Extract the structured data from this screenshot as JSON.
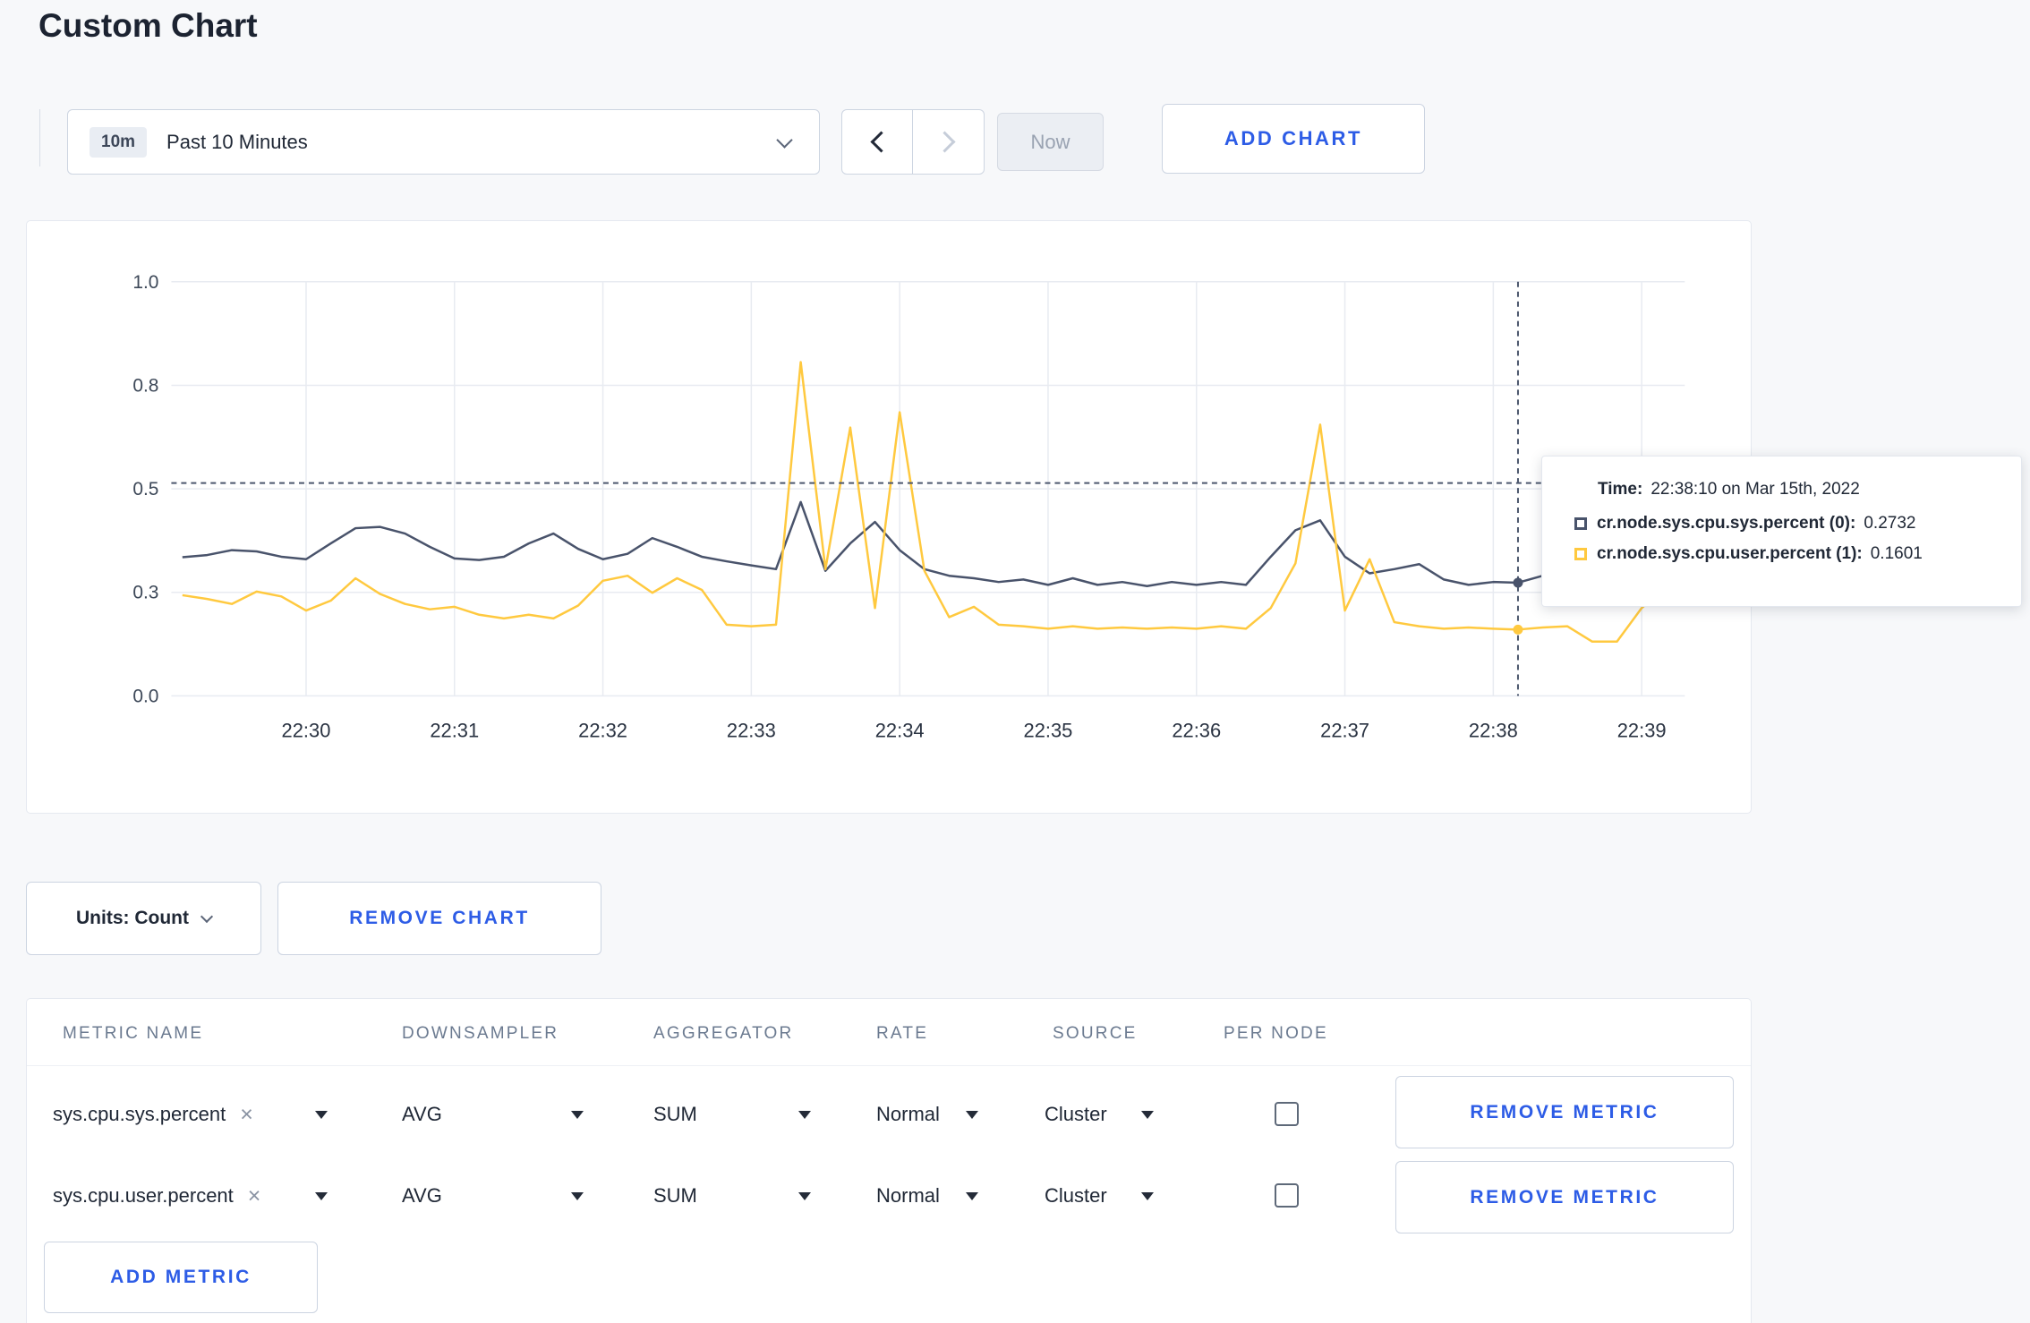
{
  "page": {
    "title": "Custom Chart"
  },
  "controls": {
    "timeframe_badge": "10m",
    "timeframe_label": "Past 10 Minutes",
    "now_label": "Now",
    "add_chart_label": "ADD CHART",
    "units_label": "Units: Count",
    "remove_chart_label": "REMOVE CHART"
  },
  "icons": {
    "clear": "×"
  },
  "tooltip": {
    "time_label": "Time:",
    "time_value": "22:38:10 on Mar 15th, 2022",
    "rows": [
      {
        "label": "cr.node.sys.cpu.sys.percent (0):",
        "value": "0.2732",
        "color": "#49536b"
      },
      {
        "label": "cr.node.sys.cpu.user.percent (1):",
        "value": "0.1601",
        "color": "#ffc93f"
      }
    ]
  },
  "chart_data": {
    "type": "line",
    "title": "",
    "xlabel": "",
    "ylabel": "",
    "ylim": [
      0,
      1
    ],
    "grid": true,
    "legend_position": "tooltip",
    "x_window": {
      "start": "22:29:00",
      "end": "22:39:00",
      "seconds": 600
    },
    "y_ticks": [
      {
        "pos": 0.0,
        "label": "0.0"
      },
      {
        "pos": 0.25,
        "label": "0.3"
      },
      {
        "pos": 0.5,
        "label": "0.5"
      },
      {
        "pos": 0.75,
        "label": "0.8"
      },
      {
        "pos": 1.0,
        "label": "1.0"
      }
    ],
    "x_ticks": [
      {
        "t": 60,
        "label": "22:30"
      },
      {
        "t": 120,
        "label": "22:31"
      },
      {
        "t": 180,
        "label": "22:32"
      },
      {
        "t": 240,
        "label": "22:33"
      },
      {
        "t": 300,
        "label": "22:34"
      },
      {
        "t": 360,
        "label": "22:35"
      },
      {
        "t": 420,
        "label": "22:36"
      },
      {
        "t": 480,
        "label": "22:37"
      },
      {
        "t": 540,
        "label": "22:38"
      },
      {
        "t": 600,
        "label": "22:39"
      }
    ],
    "crosshair": {
      "t": 550,
      "time": "22:38:10",
      "y_value": 0.514
    },
    "series": [
      {
        "name": "cr.node.sys.cpu.sys.percent",
        "color": "#49536b",
        "points": [
          [
            10,
            0.335
          ],
          [
            20,
            0.34
          ],
          [
            30,
            0.352
          ],
          [
            40,
            0.349
          ],
          [
            50,
            0.336
          ],
          [
            60,
            0.33
          ],
          [
            70,
            0.368
          ],
          [
            80,
            0.405
          ],
          [
            90,
            0.408
          ],
          [
            100,
            0.392
          ],
          [
            110,
            0.36
          ],
          [
            120,
            0.332
          ],
          [
            130,
            0.328
          ],
          [
            140,
            0.336
          ],
          [
            150,
            0.368
          ],
          [
            160,
            0.392
          ],
          [
            170,
            0.355
          ],
          [
            180,
            0.33
          ],
          [
            190,
            0.343
          ],
          [
            200,
            0.381
          ],
          [
            210,
            0.36
          ],
          [
            220,
            0.336
          ],
          [
            230,
            0.325
          ],
          [
            240,
            0.315
          ],
          [
            250,
            0.306
          ],
          [
            260,
            0.468
          ],
          [
            270,
            0.302
          ],
          [
            280,
            0.368
          ],
          [
            290,
            0.42
          ],
          [
            300,
            0.352
          ],
          [
            310,
            0.306
          ],
          [
            320,
            0.29
          ],
          [
            330,
            0.284
          ],
          [
            340,
            0.275
          ],
          [
            350,
            0.281
          ],
          [
            360,
            0.268
          ],
          [
            370,
            0.284
          ],
          [
            380,
            0.268
          ],
          [
            390,
            0.275
          ],
          [
            400,
            0.265
          ],
          [
            410,
            0.275
          ],
          [
            420,
            0.268
          ],
          [
            430,
            0.275
          ],
          [
            440,
            0.268
          ],
          [
            450,
            0.336
          ],
          [
            460,
            0.4
          ],
          [
            470,
            0.424
          ],
          [
            480,
            0.336
          ],
          [
            490,
            0.296
          ],
          [
            500,
            0.306
          ],
          [
            510,
            0.318
          ],
          [
            520,
            0.281
          ],
          [
            530,
            0.268
          ],
          [
            540,
            0.275
          ],
          [
            550,
            0.2732
          ],
          [
            560,
            0.29
          ],
          [
            570,
            0.315
          ],
          [
            580,
            0.3
          ],
          [
            590,
            0.294
          ],
          [
            600,
            0.31
          ]
        ]
      },
      {
        "name": "cr.node.sys.cpu.user.percent",
        "color": "#ffc93f",
        "points": [
          [
            10,
            0.243
          ],
          [
            20,
            0.234
          ],
          [
            30,
            0.222
          ],
          [
            40,
            0.252
          ],
          [
            50,
            0.24
          ],
          [
            60,
            0.206
          ],
          [
            70,
            0.23
          ],
          [
            80,
            0.284
          ],
          [
            90,
            0.246
          ],
          [
            100,
            0.222
          ],
          [
            110,
            0.209
          ],
          [
            120,
            0.215
          ],
          [
            130,
            0.196
          ],
          [
            140,
            0.187
          ],
          [
            150,
            0.196
          ],
          [
            160,
            0.187
          ],
          [
            170,
            0.218
          ],
          [
            180,
            0.278
          ],
          [
            190,
            0.29
          ],
          [
            200,
            0.249
          ],
          [
            210,
            0.284
          ],
          [
            220,
            0.256
          ],
          [
            230,
            0.172
          ],
          [
            240,
            0.168
          ],
          [
            250,
            0.172
          ],
          [
            260,
            0.806
          ],
          [
            270,
            0.306
          ],
          [
            280,
            0.648
          ],
          [
            290,
            0.212
          ],
          [
            300,
            0.685
          ],
          [
            310,
            0.302
          ],
          [
            320,
            0.19
          ],
          [
            330,
            0.215
          ],
          [
            340,
            0.172
          ],
          [
            350,
            0.168
          ],
          [
            360,
            0.162
          ],
          [
            370,
            0.168
          ],
          [
            380,
            0.162
          ],
          [
            390,
            0.165
          ],
          [
            400,
            0.162
          ],
          [
            410,
            0.165
          ],
          [
            420,
            0.162
          ],
          [
            430,
            0.168
          ],
          [
            440,
            0.162
          ],
          [
            450,
            0.212
          ],
          [
            460,
            0.32
          ],
          [
            470,
            0.655
          ],
          [
            480,
            0.206
          ],
          [
            490,
            0.33
          ],
          [
            500,
            0.178
          ],
          [
            510,
            0.168
          ],
          [
            520,
            0.162
          ],
          [
            530,
            0.165
          ],
          [
            540,
            0.162
          ],
          [
            550,
            0.1601
          ],
          [
            560,
            0.165
          ],
          [
            570,
            0.168
          ],
          [
            580,
            0.131
          ],
          [
            590,
            0.131
          ],
          [
            600,
            0.212
          ],
          [
            610,
            0.262
          ]
        ]
      }
    ]
  },
  "metrics_table": {
    "columns": [
      "METRIC NAME",
      "DOWNSAMPLER",
      "AGGREGATOR",
      "RATE",
      "SOURCE",
      "PER NODE"
    ],
    "rows": [
      {
        "metric": "sys.cpu.sys.percent",
        "downsampler": "AVG",
        "aggregator": "SUM",
        "rate": "Normal",
        "source": "Cluster",
        "per_node": false,
        "remove_label": "REMOVE METRIC"
      },
      {
        "metric": "sys.cpu.user.percent",
        "downsampler": "AVG",
        "aggregator": "SUM",
        "rate": "Normal",
        "source": "Cluster",
        "per_node": false,
        "remove_label": "REMOVE METRIC"
      }
    ],
    "add_metric_label": "ADD METRIC"
  }
}
